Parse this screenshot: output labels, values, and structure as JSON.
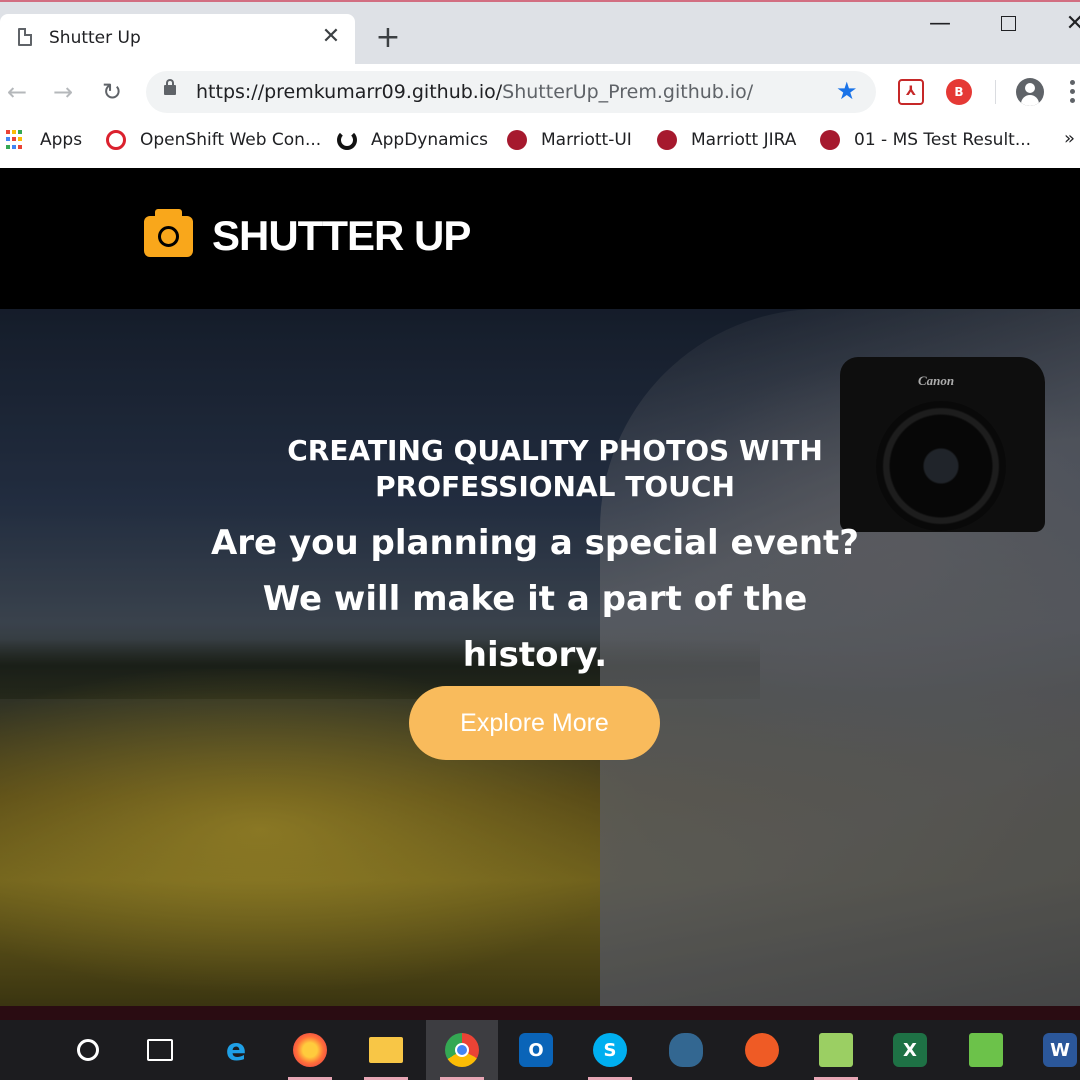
{
  "browser": {
    "tab_title": "Shutter Up",
    "tab_close": "✕",
    "new_tab": "+",
    "window_minimize": "—",
    "window_close": "✕",
    "url_host": "https://premkumarr09.github.io/",
    "url_path": "ShutterUp_Prem.github.io/",
    "nav_back": "←",
    "nav_forward": "→",
    "nav_reload": "↻",
    "star": "★",
    "ext_pdf": "⅄",
    "ext_b": "B",
    "bookmarks": [
      {
        "label": "Apps",
        "icon": "apps-grid-icon"
      },
      {
        "label": "OpenShift Web Con...",
        "icon": "openshift-icon"
      },
      {
        "label": "AppDynamics",
        "icon": "appdynamics-icon"
      },
      {
        "label": "Marriott-UI",
        "icon": "marriott-icon"
      },
      {
        "label": "Marriott JIRA",
        "icon": "marriott-icon"
      },
      {
        "label": "01 - MS Test Result...",
        "icon": "marriott-icon"
      }
    ],
    "bookmarks_more": "»"
  },
  "site": {
    "brand": "SHUTTER UP",
    "hero_subtitle": "CREATING QUALITY PHOTOS WITH PROFESSIONAL TOUCH",
    "hero_title": "Are you planning a special event? We will make it a part of the history.",
    "cta_label": "Explore More",
    "camera_brand": "Canon"
  },
  "taskbar": {
    "items": [
      {
        "name": "start-button",
        "glyph": ""
      },
      {
        "name": "cortana-button",
        "glyph": ""
      },
      {
        "name": "task-view-button",
        "glyph": ""
      },
      {
        "name": "internet-explorer",
        "glyph": "e"
      },
      {
        "name": "firefox",
        "glyph": ""
      },
      {
        "name": "file-explorer",
        "glyph": ""
      },
      {
        "name": "chrome",
        "glyph": ""
      },
      {
        "name": "outlook",
        "glyph": "O"
      },
      {
        "name": "skype",
        "glyph": "S"
      },
      {
        "name": "postgresql",
        "glyph": ""
      },
      {
        "name": "postman",
        "glyph": ""
      },
      {
        "name": "notepad-plus-plus",
        "glyph": ""
      },
      {
        "name": "excel",
        "glyph": "X"
      },
      {
        "name": "keyboard-cloud-app",
        "glyph": ""
      },
      {
        "name": "word",
        "glyph": "W"
      }
    ]
  },
  "colors": {
    "brand_accent": "#f9a71b",
    "cta_bg": "#f9bb5c",
    "header_bg": "#000000",
    "star_blue": "#1a73e8"
  }
}
